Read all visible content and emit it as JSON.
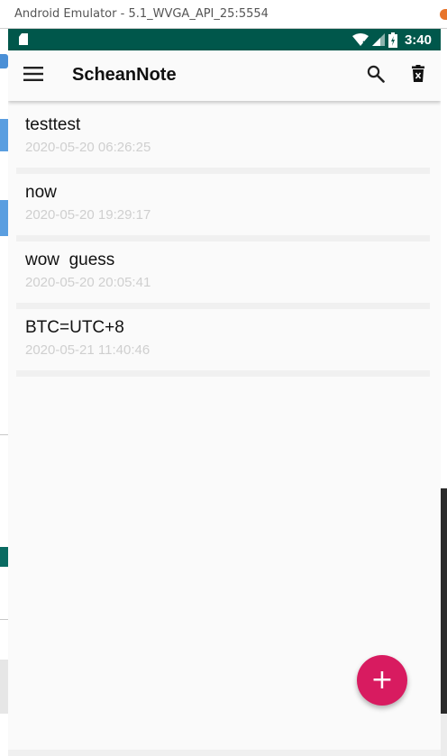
{
  "window": {
    "title": "Android Emulator - 5.1_WVGA_API_25:5554"
  },
  "statusbar": {
    "time": "3:40",
    "icons": [
      "sd-card-icon",
      "wifi-icon",
      "cell-signal-icon",
      "battery-charging-icon"
    ],
    "color": "#00574b"
  },
  "toolbar": {
    "title": "ScheanNote",
    "menu_icon": "menu-icon",
    "search_icon": "search-icon",
    "delete_icon": "delete-icon"
  },
  "notes": [
    {
      "title": "testtest",
      "date": "2020-05-20 06:26:25"
    },
    {
      "title": "now",
      "date": "2020-05-20 19:29:17"
    },
    {
      "title": "wow  guess",
      "date": "2020-05-20 20:05:41"
    },
    {
      "title": "BTC=UTC+8",
      "date": "2020-05-21 11:40:46"
    }
  ],
  "fab": {
    "label": "+",
    "icon": "add-icon",
    "color": "#d81b60"
  }
}
